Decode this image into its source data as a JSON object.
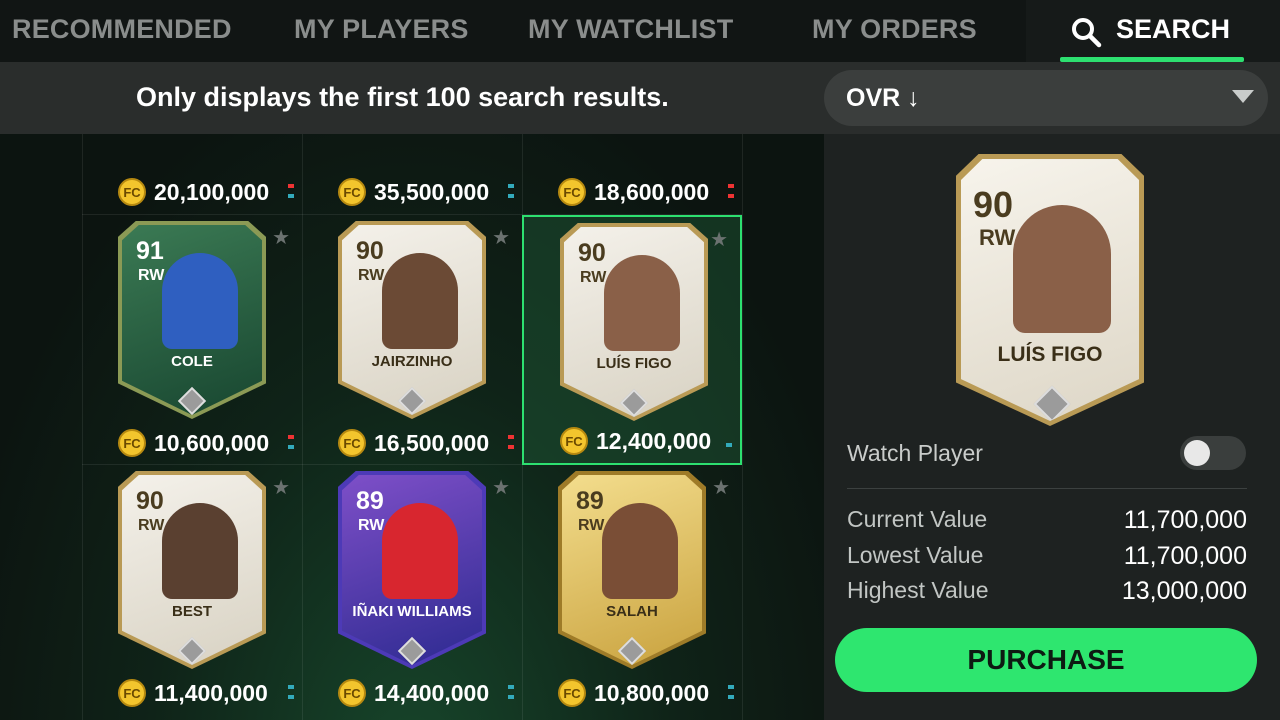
{
  "nav": {
    "tabs": [
      "RECOMMENDED",
      "MY PLAYERS",
      "MY WATCHLIST",
      "MY ORDERS"
    ],
    "active_tab": "SEARCH"
  },
  "info": {
    "message": "Only displays the first 100 search results.",
    "sort_label": "OVR ↓"
  },
  "coin_glyph": "FC",
  "top_row_prices": [
    "20,100,000",
    "35,500,000",
    "18,600,000"
  ],
  "players": [
    {
      "rating": "91",
      "pos": "RW",
      "name": "COLE",
      "price": "10,600,000",
      "style": "green"
    },
    {
      "rating": "90",
      "pos": "RW",
      "name": "JAIRZINHO",
      "price": "16,500,000",
      "style": "icon"
    },
    {
      "rating": "90",
      "pos": "RW",
      "name": "LUÍS FIGO",
      "price": "12,400,000",
      "style": "icon"
    },
    {
      "rating": "90",
      "pos": "RW",
      "name": "BEST",
      "price": "11,400,000",
      "style": "icon"
    },
    {
      "rating": "89",
      "pos": "RW",
      "name": "IÑAKI WILLIAMS",
      "price": "14,400,000",
      "style": "purple"
    },
    {
      "rating": "89",
      "pos": "RW",
      "name": "SALAH",
      "price": "10,800,000",
      "style": "gold"
    }
  ],
  "detail": {
    "rating": "90",
    "pos": "RW",
    "name": "LUÍS FIGO",
    "watch_label": "Watch Player",
    "watch_on": false,
    "current_label": "Current Value",
    "current_value": "11,700,000",
    "lowest_label": "Lowest Value",
    "lowest_value": "11,700,000",
    "highest_label": "Highest Value",
    "highest_value": "13,000,000",
    "purchase_label": "PURCHASE"
  },
  "colors": {
    "accent": "#2de070",
    "coin": "#f3c52d"
  }
}
